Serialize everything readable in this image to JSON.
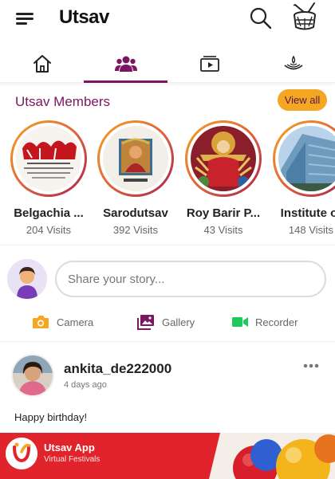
{
  "app": {
    "title": "Utsav"
  },
  "tabs": [
    {
      "icon": "home-icon",
      "active": false
    },
    {
      "icon": "members-group-icon",
      "active": true
    },
    {
      "icon": "video-play-icon",
      "active": false
    },
    {
      "icon": "diya-lamp-icon",
      "active": false
    }
  ],
  "members_section": {
    "title": "Utsav Members",
    "view_all_label": "View all"
  },
  "members": [
    {
      "name": "Belgachia ...",
      "visits": "204 Visits"
    },
    {
      "name": "Sarodutsav",
      "visits": "392 Visits"
    },
    {
      "name": "Roy Barir P...",
      "visits": "43 Visits"
    },
    {
      "name": "Institute of",
      "visits": "148 Visits"
    }
  ],
  "composer": {
    "placeholder": "Share your story...",
    "actions": [
      {
        "label": "Camera",
        "icon": "camera-icon",
        "color": "#f5a623"
      },
      {
        "label": "Gallery",
        "icon": "gallery-icon",
        "color": "#7b1760"
      },
      {
        "label": "Recorder",
        "icon": "video-recorder-icon",
        "color": "#1ec95a"
      }
    ]
  },
  "post": {
    "username": "ankita_de222000",
    "time": "4 days ago",
    "text": "Happy birthday!"
  },
  "banner": {
    "title": "Utsav App",
    "subtitle": "Virtual Festivals"
  },
  "colors": {
    "brand": "#7b1760",
    "accent": "#f5a623",
    "banner_bg": "#e1232c"
  }
}
